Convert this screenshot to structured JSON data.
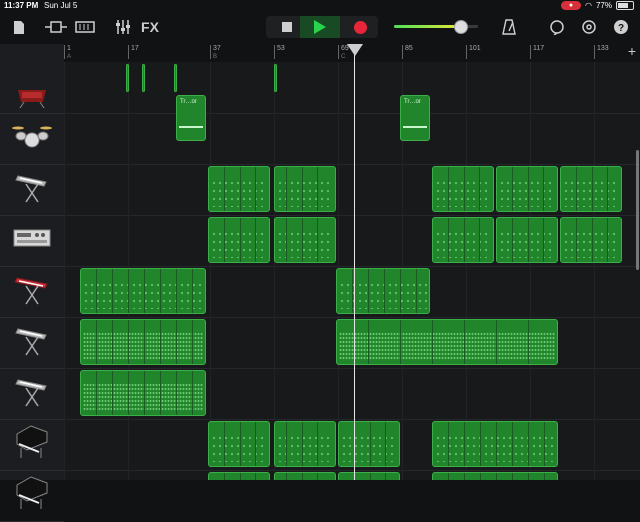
{
  "status": {
    "time": "11:37 PM",
    "date": "Sun Jul 5",
    "battery": "77%"
  },
  "toolbar": {
    "fx_label": "FX",
    "volume_level": 0.78,
    "icons": [
      "document-icon",
      "track-view-icon",
      "mixer-icon",
      "fx-icon",
      "metronome-icon",
      "loop-browser-icon",
      "settings-icon",
      "help-icon"
    ]
  },
  "ruler": {
    "bars": [
      {
        "label": "1",
        "section": "A"
      },
      {
        "label": "17",
        "section": ""
      },
      {
        "label": "37",
        "section": "B"
      },
      {
        "label": "53",
        "section": ""
      },
      {
        "label": "69",
        "section": "C"
      },
      {
        "label": "85",
        "section": ""
      },
      {
        "label": "101",
        "section": ""
      },
      {
        "label": "117",
        "section": ""
      },
      {
        "label": "133",
        "section": ""
      }
    ]
  },
  "tracks": [
    {
      "name": "drum-kit-red",
      "icon": "drum-machine-icon"
    },
    {
      "name": "drum-kit",
      "icon": "drum-kit-icon"
    },
    {
      "name": "keyboard-1",
      "icon": "keyboard-stand-icon"
    },
    {
      "name": "synth-module",
      "icon": "synth-module-icon"
    },
    {
      "name": "keyboard-red",
      "icon": "red-keyboard-icon"
    },
    {
      "name": "keyboard-2",
      "icon": "keyboard-stand-icon"
    },
    {
      "name": "keyboard-3",
      "icon": "keyboard-stand-icon"
    },
    {
      "name": "grand-piano",
      "icon": "grand-piano-icon"
    },
    {
      "name": "grand-piano-2",
      "icon": "grand-piano-icon"
    }
  ],
  "regions": {
    "drummer_label": "Tr…or"
  }
}
